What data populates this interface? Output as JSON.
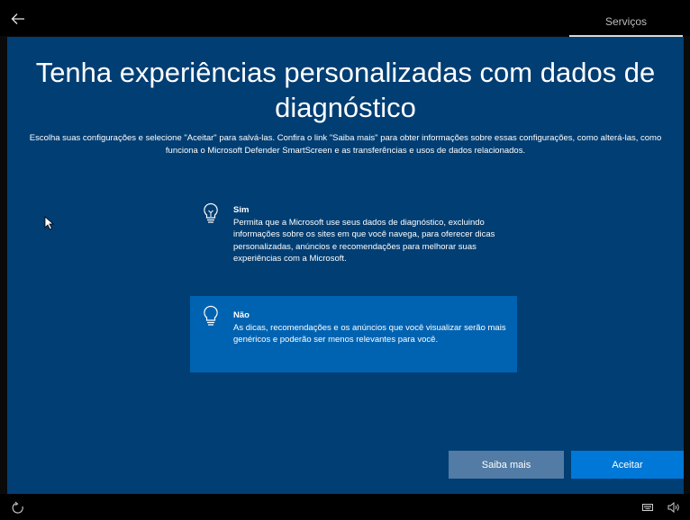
{
  "topbar": {
    "back_icon": "arrow-left-icon",
    "tab_label": "Serviços"
  },
  "main": {
    "title": "Tenha experiências personalizadas com dados de diagnóstico",
    "subtitle": "Escolha suas configurações e selecione \"Aceitar\" para salvá-las. Confira o link \"Saiba mais\" para obter informações sobre essas configurações, como alterá-las, como funciona o Microsoft Defender SmartScreen e as transferências e usos de dados relacionados.",
    "options": [
      {
        "title": "Sim",
        "description": "Permita que a Microsoft use seus dados de diagnóstico, excluindo informações sobre os sites em que você navega, para oferecer dicas personalizadas, anúncios e recomendações para melhorar suas experiências com a Microsoft.",
        "icon": "lightbulb-on-icon",
        "selected": false
      },
      {
        "title": "Não",
        "description": "As dicas, recomendações e os anúncios que você visualizar serão mais genéricos e poderão ser menos relevantes para você.",
        "icon": "lightbulb-off-icon",
        "selected": true
      }
    ],
    "buttons": {
      "learn_more": "Saiba mais",
      "accept": "Aceitar"
    }
  },
  "bottombar": {
    "icons": [
      "ease-of-access-icon",
      "keyboard-icon",
      "volume-icon"
    ]
  },
  "colors": {
    "panel": "#003e73",
    "selected_option": "#0063b1",
    "accept_button": "#0078d7",
    "learn_more_button": "#527ca5"
  }
}
